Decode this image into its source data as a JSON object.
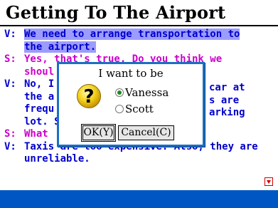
{
  "screen": {
    "title": "Getting To The Airport"
  },
  "dialogue": [
    {
      "speaker": "V:",
      "lines": [
        "We need to arrange transportation to",
        "the airport."
      ],
      "highlight": true
    },
    {
      "speaker": "S:",
      "lines": [
        "Yes, that's true. Do you think we",
        "shoul"
      ]
    },
    {
      "speaker": "V:",
      "lines": [
        "No, I",
        "the a",
        "frequ",
        "lot. S"
      ]
    },
    {
      "speaker": "S:",
      "lines": [
        "What"
      ]
    },
    {
      "speaker": "V:",
      "lines": [
        "Taxis are too expensive. Also, they are",
        "unreliable."
      ]
    }
  ],
  "dialogue_right_fragments": [
    "car at",
    "s are",
    "arking"
  ],
  "dialog": {
    "prompt": "I want to be",
    "options": [
      {
        "label": "Vanessa",
        "checked": true
      },
      {
        "label": "Scott",
        "checked": false
      }
    ],
    "ok_label": "OK(Y)",
    "cancel_label": "Cancel(C)"
  },
  "colors": {
    "v_speaker": "#0000cc",
    "s_speaker": "#cc00cc",
    "highlight": "#9c9cff",
    "dialog_border": "#1a6fc4",
    "bottom_bar": "#0057c4"
  },
  "icons": {
    "dialog": "question-icon",
    "scroll": "scroll-down-arrow-icon"
  }
}
